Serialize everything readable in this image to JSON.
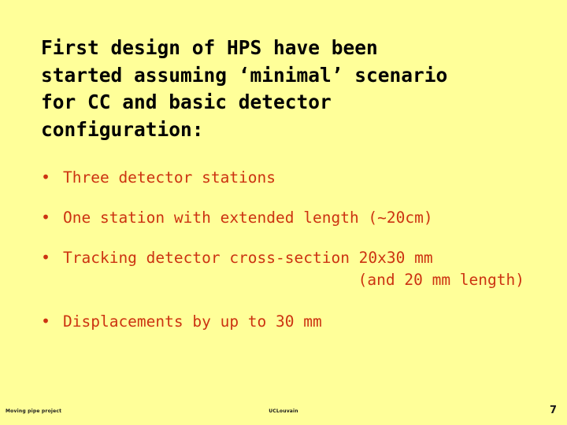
{
  "slide": {
    "background_color": "#ffff99",
    "title_color": "#000000",
    "bullet_color": "#cc3311",
    "footer_color": "#1a1a1a",
    "title_lines": [
      "First design of HPS have been",
      "started assuming ‘minimal’ scenario",
      "for CC and basic detector",
      "configuration:"
    ],
    "bullets": [
      {
        "marker": "•",
        "text": "Three detector stations",
        "continuation": ""
      },
      {
        "marker": "•",
        "text": "One station with extended length (~20cm)",
        "continuation": ""
      },
      {
        "marker": "•",
        "text": "Tracking detector cross-section 20x30 mm",
        "continuation": "(and 20 mm length)"
      },
      {
        "marker": "•",
        "text": "Displacements by up to 30 mm",
        "continuation": ""
      }
    ],
    "footer": {
      "left": "Moving pipe project",
      "center": "UCLouvain",
      "page_number": "7"
    }
  }
}
